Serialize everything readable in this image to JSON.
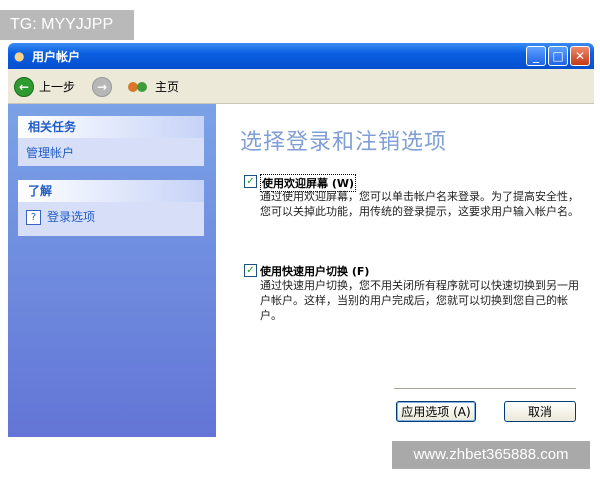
{
  "watermarks": {
    "top": "TG: MYYJJPP",
    "bottom": "www.zhbet365888.com"
  },
  "window": {
    "title": "用户帐户",
    "controls": {
      "minimize": "_",
      "maximize": "□",
      "close": "✕"
    }
  },
  "toolbar": {
    "back_label": "上一步",
    "home_label": "主页"
  },
  "sidebar": {
    "related_tasks": {
      "header": "相关任务",
      "items": [
        {
          "label": "管理帐户"
        }
      ]
    },
    "learn": {
      "header": "了解",
      "items": [
        {
          "label": "登录选项"
        }
      ]
    }
  },
  "main": {
    "heading": "选择登录和注销选项",
    "options": [
      {
        "label": "使用欢迎屏幕 (W)",
        "checked": true,
        "description": "通过使用欢迎屏幕，您可以单击帐户名来登录。为了提高安全性，您可以关掉此功能，用传统的登录提示，这要求用户输入帐户名。"
      },
      {
        "label": "使用快速用户切换 (F)",
        "checked": true,
        "description": "通过快速用户切换，您不用关闭所有程序就可以快速切换到另一用户帐户。这样，当别的用户完成后，您就可以切换到您自己的帐户。"
      }
    ],
    "buttons": {
      "apply": "应用选项 (A)",
      "cancel": "取消"
    }
  }
}
